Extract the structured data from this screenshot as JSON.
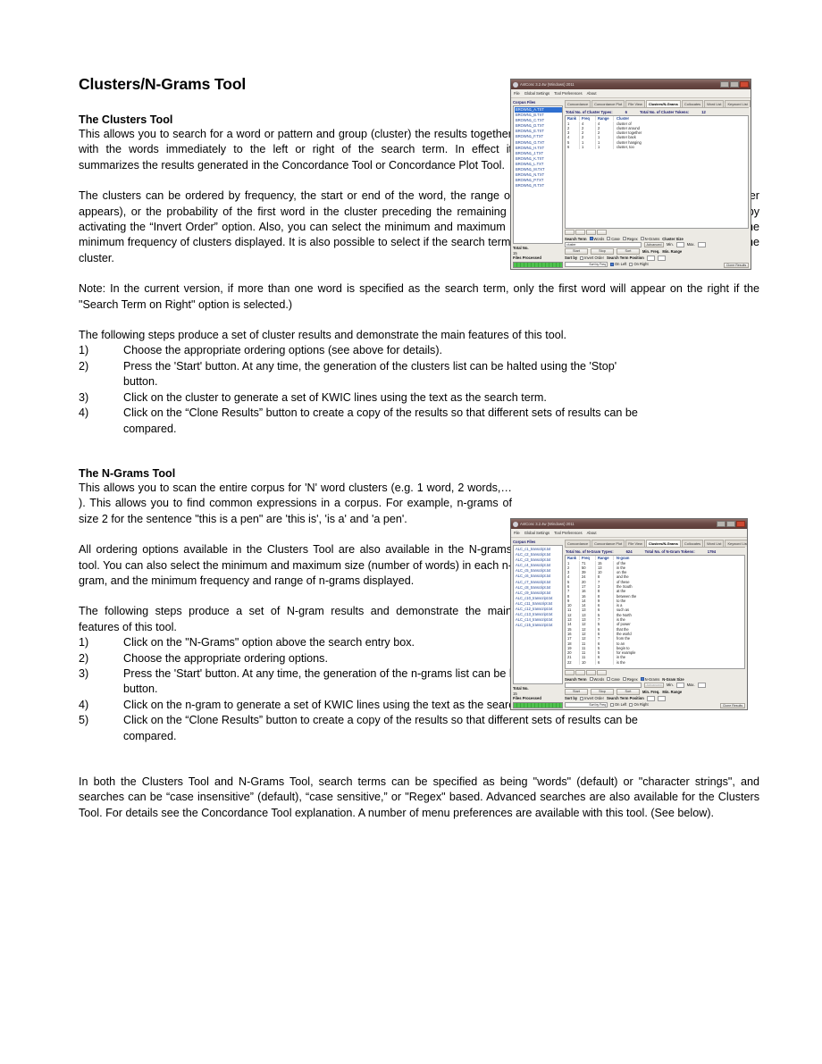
{
  "document": {
    "title": "Clusters/N-Grams Tool",
    "sections": [
      {
        "heading": "The Clusters Tool",
        "paragraphs": [
          "This allows you to search for a word or pattern and group (cluster) the results together with the words immediately to the left or right of the search term. In effect it summarizes the results generated in the Concordance Tool or Concordance Plot Tool.",
          "The clusters can be ordered by frequency, the start or end of the word, the range of the cluster (number of files in which the cluster appears), or the probability of the first word in the cluster preceding the remaining words. All list orderings can also be inverted by activating the “Invert Order” option. Also, you can select the minimum and maximum length (number of words) in each cluster, and the minimum frequency of clusters displayed. It is also possible to select if the search term always appears on the left (default) or right of the cluster.",
          "Note: In the current version, if more than one word is specified as the search term, only the first word will appear on the right if the \"Search Term on Right\" option is selected.)",
          "The following steps produce a set of cluster results and demonstrate the main features of this tool."
        ],
        "steps": [
          {
            "num": "1)",
            "text": "Choose the appropriate ordering options (see above for details)."
          },
          {
            "num": "2)",
            "text": "Press the 'Start' button. At any time, the generation of the clusters list can be halted using the 'Stop'",
            "cont": "button."
          },
          {
            "num": "3)",
            "text": "Click on the cluster to generate a set of KWIC lines using the text as the search term."
          },
          {
            "num": "4)",
            "text": "Click on the “Clone Results” button to create a copy of the results so that different sets of results can be",
            "cont": "compared."
          }
        ]
      },
      {
        "heading": "The N-Grams Tool",
        "paragraphs": [
          "This allows you to scan the entire corpus for 'N'  word clusters (e.g. 1 word, 2 words,… ). This allows you to find common expressions in a corpus. For example, n-grams of size 2 for the sentence \"this is a pen\" are 'this is', 'is a' and 'a pen'.",
          "All ordering options available in the Clusters Tool are also available in the N-grams tool. You can also select the minimum and maximum size (number of words) in each n-gram, and the minimum frequency and range of n-grams displayed.",
          "The following steps produce a set of N-gram results and demonstrate the main features of this tool."
        ],
        "steps": [
          {
            "num": "1)",
            "text": "Click on the \"N-Grams\" option above the search entry box."
          },
          {
            "num": "2)",
            "text": "Choose the appropriate ordering options."
          },
          {
            "num": "3)",
            "text": "Press the 'Start' button. At any time, the generation of the n-grams list can be halted using the 'Stop'",
            "cont": "button."
          },
          {
            "num": "4)",
            "text": "Click on the n-gram to generate a set of KWIC lines using the text as the search term."
          },
          {
            "num": "5)",
            "text": "Click on the “Clone Results” button to create a copy of the results so that different sets of results can be",
            "cont": "compared."
          }
        ]
      }
    ],
    "closing_paragraph": "In both the Clusters Tool and N-Grams Tool, search terms can be specified as being \"words\" (default) or \"character strings\", and searches can be “case insensitive” (default), “case sensitive,” or \"Regex\" based. Advanced searches are also available for the Clusters Tool. For details see the Concordance Tool explanation. A number of menu preferences are available with this tool. (See below)."
  },
  "screenshot_clusters": {
    "window_title": "AntConc 3.2.4w (Windows) 2011",
    "menu_items": [
      "File",
      "Global Settings",
      "Tool Preferences",
      "About"
    ],
    "corpus_files_label": "Corpus Files",
    "files": [
      "BROWN1_A.TXT",
      "BROWN1_B.TXT",
      "BROWN1_C.TXT",
      "BROWN1_D.TXT",
      "BROWN1_E.TXT",
      "BROWN1_F.TXT",
      "BROWN1_G.TXT",
      "BROWN1_H.TXT",
      "BROWN1_J.TXT",
      "BROWN1_K.TXT",
      "BROWN1_L.TXT",
      "BROWN1_M.TXT",
      "BROWN1_N.TXT",
      "BROWN1_P.TXT",
      "BROWN1_R.TXT"
    ],
    "selected_file": "BROWN1_A.TXT",
    "tabs": [
      "Concordance",
      "Concordance Plot",
      "File View",
      "Clusters/N-Grams",
      "Collocates",
      "Word List",
      "Keyword List"
    ],
    "active_tab": "Clusters/N-Grams",
    "total_types_label": "Total No. of Cluster Types:",
    "total_types_value": "6",
    "total_tokens_label": "Total No. of Cluster Tokens:",
    "total_tokens_value": "12",
    "columns": [
      "Rank",
      "Freq",
      "Range",
      "Cluster"
    ],
    "rows": [
      {
        "rank": "1",
        "freq": "4",
        "range": "4",
        "text": "cluster of"
      },
      {
        "rank": "2",
        "freq": "2",
        "range": "2",
        "text": "cluster around"
      },
      {
        "rank": "3",
        "freq": "2",
        "range": "2",
        "text": "cluster together"
      },
      {
        "rank": "4",
        "freq": "2",
        "range": "1",
        "text": "cluster back"
      },
      {
        "rank": "5",
        "freq": "1",
        "range": "1",
        "text": "cluster hanging"
      },
      {
        "rank": "6",
        "freq": "1",
        "range": "1",
        "text": "cluster, too"
      }
    ],
    "total_no_label": "Total No.",
    "total_no_value": "15",
    "files_processed_label": "Files Processed",
    "search_term_label": "Search Term",
    "search_options": [
      "Words",
      "Case",
      "Regex",
      "N-Grams"
    ],
    "search_value": "cluster",
    "advanced_label": "Advanced",
    "cluster_size_label": "Cluster Size",
    "min_label": "Min.",
    "min_value": "2",
    "max_label": "Max.",
    "max_value": "2",
    "start_label": "Start",
    "stop_label": "Stop",
    "sort_label": "Sort",
    "min_freq_label": "Min. Freq.",
    "min_freq_value": "1",
    "min_range_label": "Min. Range",
    "min_range_value": "1",
    "sort_by_label": "Sort by",
    "invert_order_label": "Invert Order",
    "sort_by_value": "Sort by Freq",
    "search_term_position_label": "Search Term Position",
    "on_left_label": "On Left",
    "on_right_label": "On Right",
    "clone_results_label": "Clone Results",
    "accent_color": "#1b3f8f",
    "titlebar_color": "#5c3c38",
    "progress_color": "#4ec24e"
  },
  "screenshot_ngrams": {
    "window_title": "AntConc 3.2.4w (Windows) 2011",
    "menu_items": [
      "File",
      "Global Settings",
      "Tool Preferences",
      "About"
    ],
    "corpus_files_label": "Corpus Files",
    "files": [
      "ALC_c1_transcript.txt",
      "ALC_c2_transcript.txt",
      "ALC_c3_transcript.txt",
      "ALC_c4_transcript.txt",
      "ALC_c5_transcript.txt",
      "ALC_c6_transcript.txt",
      "ALC_c7_transcript.txt",
      "ALC_c8_transcript.txt",
      "ALC_c9_transcript.txt",
      "ALC_c10_transcript.txt",
      "ALC_c11_transcript.txt",
      "ALC_c12_transcript.txt",
      "ALC_c13_transcript.txt",
      "ALC_c14_transcript.txt",
      "ALC_c15_transcript.txt"
    ],
    "selected_file": "",
    "tabs": [
      "Concordance",
      "Concordance Plot",
      "File View",
      "Clusters/N-Grams",
      "Collocates",
      "Word List",
      "Keyword List"
    ],
    "active_tab": "Clusters/N-Grams",
    "total_types_label": "Total No. of N-Gram Types:",
    "total_types_value": "624",
    "total_tokens_label": "Total No. of N-Gram Tokens:",
    "total_tokens_value": "1794",
    "columns": [
      "Rank",
      "Freq",
      "Range",
      "N-gram"
    ],
    "rows": [
      {
        "rank": "1",
        "freq": "71",
        "range": "15",
        "text": "of the"
      },
      {
        "rank": "2",
        "freq": "50",
        "range": "13",
        "text": "in the"
      },
      {
        "rank": "3",
        "freq": "39",
        "range": "10",
        "text": "on the"
      },
      {
        "rank": "4",
        "freq": "24",
        "range": "8",
        "text": "and the"
      },
      {
        "rank": "5",
        "freq": "20",
        "range": "7",
        "text": "of these"
      },
      {
        "rank": "6",
        "freq": "17",
        "range": "3",
        "text": "the South"
      },
      {
        "rank": "7",
        "freq": "16",
        "range": "8",
        "text": "at the"
      },
      {
        "rank": "8",
        "freq": "16",
        "range": "8",
        "text": "between the"
      },
      {
        "rank": "9",
        "freq": "14",
        "range": "9",
        "text": "to the"
      },
      {
        "rank": "10",
        "freq": "14",
        "range": "6",
        "text": "is a"
      },
      {
        "rank": "11",
        "freq": "13",
        "range": "6",
        "text": "such as"
      },
      {
        "rank": "12",
        "freq": "13",
        "range": "5",
        "text": "the North"
      },
      {
        "rank": "13",
        "freq": "13",
        "range": "7",
        "text": "is the"
      },
      {
        "rank": "14",
        "freq": "12",
        "range": "5",
        "text": "of power"
      },
      {
        "rank": "15",
        "freq": "12",
        "range": "6",
        "text": "that the"
      },
      {
        "rank": "16",
        "freq": "12",
        "range": "6",
        "text": "the world"
      },
      {
        "rank": "17",
        "freq": "12",
        "range": "7",
        "text": "from the"
      },
      {
        "rank": "18",
        "freq": "11",
        "range": "6",
        "text": "to an"
      },
      {
        "rank": "19",
        "freq": "11",
        "range": "5",
        "text": "begin to"
      },
      {
        "rank": "20",
        "freq": "11",
        "range": "5",
        "text": "for example"
      },
      {
        "rank": "21",
        "freq": "11",
        "range": "6",
        "text": "in the"
      },
      {
        "rank": "22",
        "freq": "10",
        "range": "6",
        "text": "is the"
      }
    ],
    "total_no_label": "Total No.",
    "total_no_value": "15",
    "files_processed_label": "Files Processed",
    "search_term_label": "Search Term",
    "search_options": [
      "Words",
      "Case",
      "Regex",
      "N-Grams"
    ],
    "search_value": "",
    "advanced_label": "Advanced",
    "cluster_size_label": "N-Gram Size",
    "min_label": "Min.",
    "min_value": "2",
    "max_label": "Max.",
    "max_value": "2",
    "start_label": "Start",
    "stop_label": "Stop",
    "sort_label": "Sort",
    "min_freq_label": "Min. Freq.",
    "min_freq_value": "1",
    "min_range_label": "Min. Range",
    "min_range_value": "1",
    "sort_by_label": "Sort by",
    "invert_order_label": "Invert Order",
    "sort_by_value": "Sort by Freq",
    "search_term_position_label": "Search Term Position",
    "on_left_label": "On Left",
    "on_right_label": "On Right",
    "clone_results_label": "Clone Results",
    "accent_color": "#1b3f8f",
    "titlebar_color": "#5c3c38",
    "progress_color": "#4ec24e"
  }
}
